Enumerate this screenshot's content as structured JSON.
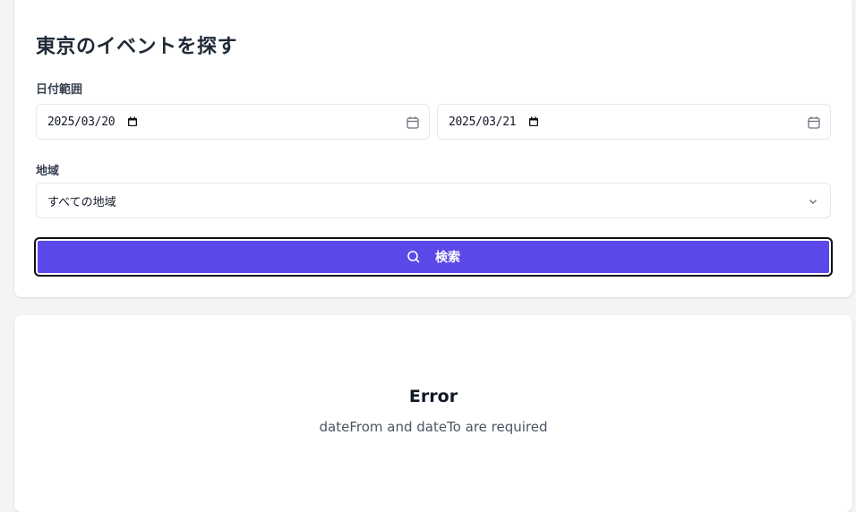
{
  "search": {
    "title": "東京のイベントを探す",
    "date_label": "日付範囲",
    "date_from": "2025/03/20",
    "date_to": "2025/03/21",
    "region_label": "地域",
    "region_selected": "すべての地域",
    "button_label": "検索",
    "button_icon": "search-icon",
    "accent_color": "#5a49e8"
  },
  "error": {
    "title": "Error",
    "message": "dateFrom and dateTo are required"
  }
}
